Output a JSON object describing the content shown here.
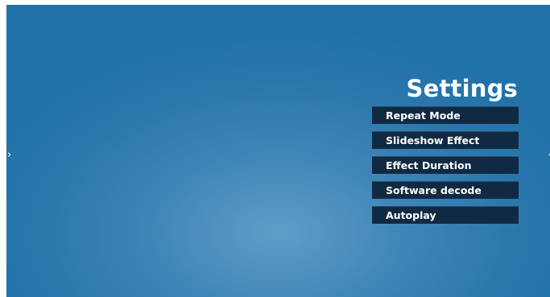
{
  "screen": {
    "title": "Settings",
    "left_arrow": "›",
    "right_arrow": "‹"
  },
  "menu": {
    "items": [
      {
        "label": "Repeat Mode"
      },
      {
        "label": "Slideshow Effect"
      },
      {
        "label": "Effect Duration"
      },
      {
        "label": "Software decode"
      },
      {
        "label": "Autoplay"
      }
    ]
  },
  "colors": {
    "background": "#2c78ad",
    "menu_item_bg": "#112a44",
    "text": "#ffffff"
  }
}
